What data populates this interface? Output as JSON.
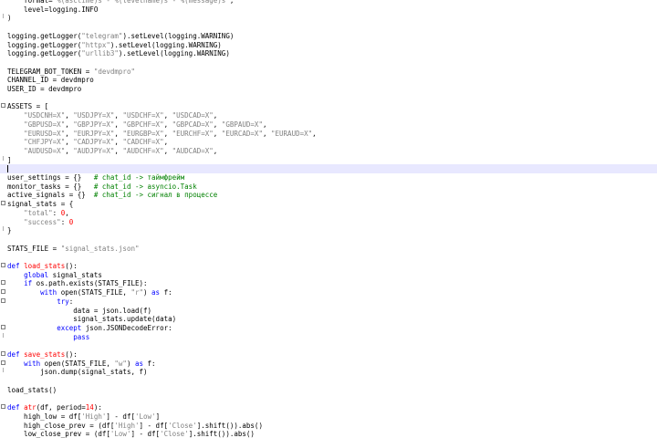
{
  "colors": {
    "keyword": "#0000ff",
    "string": "#808080",
    "number": "#ff0000",
    "comment": "#008000",
    "function_name": "#ff0000",
    "operator": "#000080",
    "current_line": "#e8e8ff"
  },
  "lines": [
    {
      "id": "l1",
      "tokens": [
        {
          "t": "    format='"
        },
        {
          "t": "%(asctime)s - %(levelname)s - %(message)s",
          "c": "str"
        },
        {
          "t": "',"
        }
      ]
    },
    {
      "id": "l2",
      "tokens": [
        {
          "t": "    level=logging.INFO"
        }
      ]
    },
    {
      "id": "l3",
      "tokens": [
        {
          "t": ")"
        }
      ],
      "fold": "end"
    },
    {
      "id": "l4",
      "tokens": []
    },
    {
      "id": "l5",
      "tokens": [
        {
          "t": "logging.getLogger("
        },
        {
          "t": "\"telegram\"",
          "c": "str"
        },
        {
          "t": ").setLevel(logging.WARNING)"
        }
      ]
    },
    {
      "id": "l6",
      "tokens": [
        {
          "t": "logging.getLogger("
        },
        {
          "t": "\"httpx\"",
          "c": "str"
        },
        {
          "t": ").setLevel(logging.WARNING)"
        }
      ]
    },
    {
      "id": "l7",
      "tokens": [
        {
          "t": "logging.getLogger("
        },
        {
          "t": "\"urllib3\"",
          "c": "str"
        },
        {
          "t": ").setLevel(logging.WARNING)"
        }
      ]
    },
    {
      "id": "l8",
      "tokens": []
    },
    {
      "id": "l9",
      "tokens": [
        {
          "t": "TELEGRAM_BOT_TOKEN = "
        },
        {
          "t": "\"devdmpro\"",
          "c": "str"
        }
      ]
    },
    {
      "id": "l10",
      "tokens": [
        {
          "t": "CHANNEL_ID = devdmpro"
        }
      ]
    },
    {
      "id": "l11",
      "tokens": [
        {
          "t": "USER_ID = devdmpro"
        }
      ]
    },
    {
      "id": "l12",
      "tokens": []
    },
    {
      "id": "l13",
      "tokens": [
        {
          "t": "ASSETS = ["
        }
      ],
      "fold": "start"
    },
    {
      "id": "l14",
      "tokens": [
        {
          "t": "    "
        },
        {
          "t": "\"USDCNH=X\"",
          "c": "str"
        },
        {
          "t": ", "
        },
        {
          "t": "\"USDJPY=X\"",
          "c": "str"
        },
        {
          "t": ", "
        },
        {
          "t": "\"USDCHF=X\"",
          "c": "str"
        },
        {
          "t": ", "
        },
        {
          "t": "\"USDCAD=X\"",
          "c": "str"
        },
        {
          "t": ","
        }
      ]
    },
    {
      "id": "l15",
      "tokens": [
        {
          "t": "    "
        },
        {
          "t": "\"GBPUSD=X\"",
          "c": "str"
        },
        {
          "t": ", "
        },
        {
          "t": "\"GBPJPY=X\"",
          "c": "str"
        },
        {
          "t": ", "
        },
        {
          "t": "\"GBPCHF=X\"",
          "c": "str"
        },
        {
          "t": ", "
        },
        {
          "t": "\"GBPCAD=X\"",
          "c": "str"
        },
        {
          "t": ", "
        },
        {
          "t": "\"GBPAUD=X\"",
          "c": "str"
        },
        {
          "t": ","
        }
      ]
    },
    {
      "id": "l16",
      "tokens": [
        {
          "t": "    "
        },
        {
          "t": "\"EURUSD=X\"",
          "c": "str"
        },
        {
          "t": ", "
        },
        {
          "t": "\"EURJPY=X\"",
          "c": "str"
        },
        {
          "t": ", "
        },
        {
          "t": "\"EURGBP=X\"",
          "c": "str"
        },
        {
          "t": ", "
        },
        {
          "t": "\"EURCHF=X\"",
          "c": "str"
        },
        {
          "t": ", "
        },
        {
          "t": "\"EURCAD=X\"",
          "c": "str"
        },
        {
          "t": ", "
        },
        {
          "t": "\"EURAUD=X\"",
          "c": "str"
        },
        {
          "t": ","
        }
      ]
    },
    {
      "id": "l17",
      "tokens": [
        {
          "t": "    "
        },
        {
          "t": "\"CHFJPY=X\"",
          "c": "str"
        },
        {
          "t": ", "
        },
        {
          "t": "\"CADJPY=X\"",
          "c": "str"
        },
        {
          "t": ", "
        },
        {
          "t": "\"CADCHF=X\"",
          "c": "str"
        },
        {
          "t": ","
        }
      ]
    },
    {
      "id": "l18",
      "tokens": [
        {
          "t": "    "
        },
        {
          "t": "\"AUDUSD=X\"",
          "c": "str"
        },
        {
          "t": ", "
        },
        {
          "t": "\"AUDJPY=X\"",
          "c": "str"
        },
        {
          "t": ", "
        },
        {
          "t": "\"AUDCHF=X\"",
          "c": "str"
        },
        {
          "t": ", "
        },
        {
          "t": "\"AUDCAD=X\"",
          "c": "str"
        },
        {
          "t": ","
        }
      ]
    },
    {
      "id": "l19",
      "tokens": [
        {
          "t": "]"
        }
      ],
      "fold": "end"
    },
    {
      "id": "l20",
      "tokens": [],
      "current": true
    },
    {
      "id": "l21",
      "tokens": [
        {
          "t": "user_settings = {}   "
        },
        {
          "t": "# chat_id -> таймфрейм",
          "c": "cm"
        }
      ]
    },
    {
      "id": "l22",
      "tokens": [
        {
          "t": "monitor_tasks = {}   "
        },
        {
          "t": "# chat_id -> asyncio.Task",
          "c": "cm"
        }
      ]
    },
    {
      "id": "l23",
      "tokens": [
        {
          "t": "active_signals = {}  "
        },
        {
          "t": "# chat_id -> сигнал в процессе",
          "c": "cm"
        }
      ]
    },
    {
      "id": "l24",
      "tokens": [
        {
          "t": "signal_stats = {"
        }
      ],
      "fold": "start"
    },
    {
      "id": "l25",
      "tokens": [
        {
          "t": "    "
        },
        {
          "t": "\"total\"",
          "c": "str"
        },
        {
          "t": ": "
        },
        {
          "t": "0",
          "c": "num"
        },
        {
          "t": ","
        }
      ]
    },
    {
      "id": "l26",
      "tokens": [
        {
          "t": "    "
        },
        {
          "t": "\"success\"",
          "c": "str"
        },
        {
          "t": ": "
        },
        {
          "t": "0",
          "c": "num"
        }
      ]
    },
    {
      "id": "l27",
      "tokens": [
        {
          "t": "}"
        }
      ],
      "fold": "end"
    },
    {
      "id": "l28",
      "tokens": []
    },
    {
      "id": "l29",
      "tokens": [
        {
          "t": "STATS_FILE = "
        },
        {
          "t": "\"signal_stats.json\"",
          "c": "str"
        }
      ]
    },
    {
      "id": "l30",
      "tokens": []
    },
    {
      "id": "l31",
      "tokens": [
        {
          "t": "def ",
          "c": "kw"
        },
        {
          "t": "load_stats",
          "c": "fn"
        },
        {
          "t": "():"
        }
      ],
      "fold": "start"
    },
    {
      "id": "l32",
      "tokens": [
        {
          "t": "    "
        },
        {
          "t": "global",
          "c": "kw"
        },
        {
          "t": " signal_stats"
        }
      ]
    },
    {
      "id": "l33",
      "tokens": [
        {
          "t": "    "
        },
        {
          "t": "if",
          "c": "kw"
        },
        {
          "t": " os.path.exists(STATS_FILE):"
        }
      ],
      "fold": "start"
    },
    {
      "id": "l34",
      "tokens": [
        {
          "t": "        "
        },
        {
          "t": "with",
          "c": "kw"
        },
        {
          "t": " open(STATS_FILE, "
        },
        {
          "t": "\"r\"",
          "c": "str"
        },
        {
          "t": ") "
        },
        {
          "t": "as",
          "c": "kw"
        },
        {
          "t": " f:"
        }
      ],
      "fold": "start"
    },
    {
      "id": "l35",
      "tokens": [
        {
          "t": "            "
        },
        {
          "t": "try",
          "c": "kw"
        },
        {
          "t": ":"
        }
      ],
      "fold": "start"
    },
    {
      "id": "l36",
      "tokens": [
        {
          "t": "                data = json.load(f)"
        }
      ]
    },
    {
      "id": "l37",
      "tokens": [
        {
          "t": "                signal_stats.update(data)"
        }
      ]
    },
    {
      "id": "l38",
      "tokens": [
        {
          "t": "            "
        },
        {
          "t": "except",
          "c": "kw"
        },
        {
          "t": " json.JSONDecodeError:"
        }
      ],
      "fold": "start"
    },
    {
      "id": "l39",
      "tokens": [
        {
          "t": "                "
        },
        {
          "t": "pass",
          "c": "kw"
        }
      ],
      "fold": "end"
    },
    {
      "id": "l40",
      "tokens": []
    },
    {
      "id": "l41",
      "tokens": [
        {
          "t": "def ",
          "c": "kw"
        },
        {
          "t": "save_stats",
          "c": "fn"
        },
        {
          "t": "():"
        }
      ],
      "fold": "start"
    },
    {
      "id": "l42",
      "tokens": [
        {
          "t": "    "
        },
        {
          "t": "with",
          "c": "kw"
        },
        {
          "t": " open(STATS_FILE, "
        },
        {
          "t": "\"w\"",
          "c": "str"
        },
        {
          "t": ") "
        },
        {
          "t": "as",
          "c": "kw"
        },
        {
          "t": " f:"
        }
      ],
      "fold": "start"
    },
    {
      "id": "l43",
      "tokens": [
        {
          "t": "        json.dump(signal_stats, f)"
        }
      ],
      "fold": "end"
    },
    {
      "id": "l44",
      "tokens": []
    },
    {
      "id": "l45",
      "tokens": [
        {
          "t": "load_stats()"
        }
      ]
    },
    {
      "id": "l46",
      "tokens": []
    },
    {
      "id": "l47",
      "tokens": [
        {
          "t": "def ",
          "c": "kw"
        },
        {
          "t": "atr",
          "c": "fn"
        },
        {
          "t": "(df, period="
        },
        {
          "t": "14",
          "c": "num"
        },
        {
          "t": "):"
        }
      ],
      "fold": "start"
    },
    {
      "id": "l48",
      "tokens": [
        {
          "t": "    high_low = df["
        },
        {
          "t": "'High'",
          "c": "str"
        },
        {
          "t": "] - df["
        },
        {
          "t": "'Low'",
          "c": "str"
        },
        {
          "t": "]"
        }
      ]
    },
    {
      "id": "l49",
      "tokens": [
        {
          "t": "    high_close_prev = (df["
        },
        {
          "t": "'High'",
          "c": "str"
        },
        {
          "t": "] - df["
        },
        {
          "t": "'Close'",
          "c": "str"
        },
        {
          "t": "].shift()).abs()"
        }
      ]
    },
    {
      "id": "l50",
      "tokens": [
        {
          "t": "    low_close_prev = (df["
        },
        {
          "t": "'Low'",
          "c": "str"
        },
        {
          "t": "] - df["
        },
        {
          "t": "'Close'",
          "c": "str"
        },
        {
          "t": "].shift()).abs()"
        }
      ]
    }
  ]
}
